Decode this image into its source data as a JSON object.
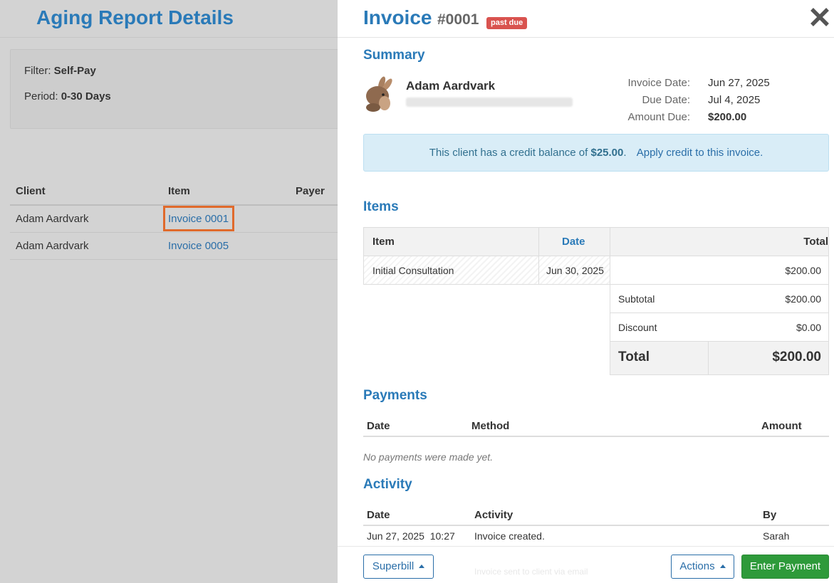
{
  "background": {
    "title": "Aging Report Details",
    "filter_label": "Filter:",
    "filter_value": "Self-Pay",
    "period_label": "Period:",
    "period_value": "0-30 Days",
    "table": {
      "headers": [
        "Client",
        "Item",
        "Payer"
      ],
      "rows": [
        {
          "client": "Adam Aardvark",
          "item": "Invoice 0001"
        },
        {
          "client": "Adam Aardvark",
          "item": "Invoice 0005"
        }
      ]
    }
  },
  "invoice": {
    "title": "Invoice",
    "number": "#0001",
    "badge": "past due",
    "close_icon": "close-icon"
  },
  "summary": {
    "heading": "Summary",
    "client_name": "Adam Aardvark",
    "invoice_date_label": "Invoice Date:",
    "invoice_date": "Jun 27, 2025",
    "due_date_label": "Due Date:",
    "due_date": "Jul 4, 2025",
    "amount_due_label": "Amount Due:",
    "amount_due": "$200.00",
    "credit_text": "This client has a credit balance of",
    "credit_amount": "$25.00",
    "credit_period": ".",
    "credit_link": "Apply credit to this invoice."
  },
  "items": {
    "heading": "Items",
    "headers": {
      "item": "Item",
      "date": "Date",
      "total": "Total"
    },
    "rows": [
      {
        "item": "Initial Consultation",
        "date": "Jun 30, 2025",
        "total": "$200.00"
      }
    ],
    "subtotal_label": "Subtotal",
    "subtotal": "$200.00",
    "discount_label": "Discount",
    "discount": "$0.00",
    "total_label": "Total",
    "total": "$200.00"
  },
  "payments": {
    "heading": "Payments",
    "headers": {
      "date": "Date",
      "method": "Method",
      "amount": "Amount"
    },
    "empty": "No payments were made yet."
  },
  "activity": {
    "heading": "Activity",
    "headers": {
      "date": "Date",
      "activity": "Activity",
      "by": "By"
    },
    "rows": [
      {
        "date": "Jun 27, 2025  10:27",
        "activity": "Invoice created.",
        "by": "Sarah"
      }
    ],
    "partial_row": {
      "activity": "Invoice sent to client via email"
    }
  },
  "footer": {
    "superbill": "Superbill",
    "actions": "Actions",
    "enter_payment": "Enter Payment"
  },
  "colors": {
    "accent": "#2a7ab8",
    "badge": "#d9534f",
    "highlight": "#e06a2c",
    "primary_button": "#2e9a3a"
  }
}
